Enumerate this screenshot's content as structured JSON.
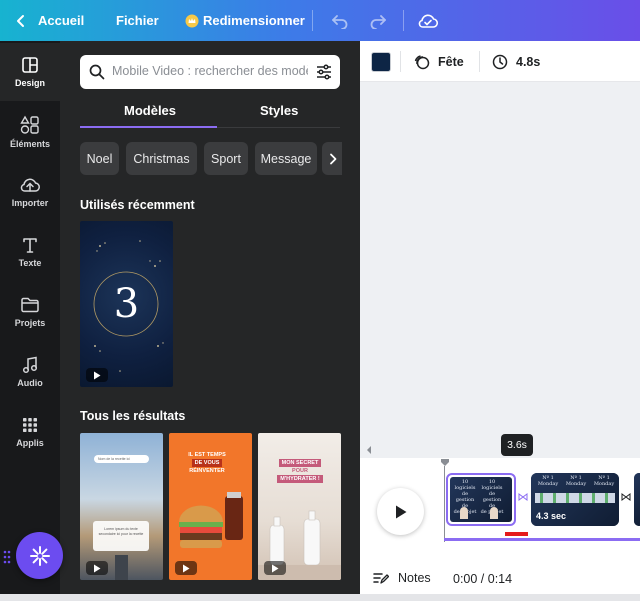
{
  "topbar": {
    "back_label": "Accueil",
    "file_label": "Fichier",
    "resize_label": "Redimensionner"
  },
  "rail": {
    "items": [
      {
        "label": "Design",
        "icon": "layout-icon"
      },
      {
        "label": "Éléments",
        "icon": "shapes-icon"
      },
      {
        "label": "Importer",
        "icon": "cloud-upload-icon"
      },
      {
        "label": "Texte",
        "icon": "text-icon"
      },
      {
        "label": "Projets",
        "icon": "folder-icon"
      },
      {
        "label": "Audio",
        "icon": "music-icon"
      },
      {
        "label": "Applis",
        "icon": "apps-grid-icon"
      }
    ]
  },
  "panel": {
    "search_placeholder": "Mobile Video : rechercher des modèles",
    "tabs": [
      "Modèles",
      "Styles"
    ],
    "chips": [
      "Noel",
      "Christmas",
      "Sport",
      "Message",
      "D"
    ],
    "recent_title": "Utilisés récemment",
    "recent_thumb_text": "3",
    "results_title": "Tous les résultats",
    "result_cards": [
      {
        "lines": [
          "Nom de la recette ici",
          "Lorem ipsum du texte",
          "secondaire ici pour la recette"
        ]
      },
      {
        "lines": [
          "IL EST TEMPS",
          "DE VOUS",
          "RÉINVENTER"
        ]
      },
      {
        "lines": [
          "MON SECRET",
          "POUR",
          "M'HYDRATER !"
        ]
      }
    ]
  },
  "canvas_toolbar": {
    "color": "#0d2545",
    "animation_label": "Fête",
    "duration_label": "4.8s"
  },
  "timeline": {
    "tooltip": "3.6s",
    "clip2_duration": "4.3 sec",
    "clip1_text": [
      "10",
      "10",
      "logiciels",
      "logiciels",
      "de gestion de",
      "de gestion de",
      "de projet",
      "de projet"
    ],
    "clip2_text": [
      "Nº 1",
      "Nº 1",
      "Nº 1",
      "Monday",
      "Monday",
      "Monday"
    ]
  },
  "footer": {
    "notes_label": "Notes",
    "time": "0:00 / 0:14"
  },
  "colors": {
    "accent": "#8b6cf2",
    "magic_button": "#6c4cf0",
    "panel_bg": "#252627",
    "rail_bg": "#18191b"
  }
}
